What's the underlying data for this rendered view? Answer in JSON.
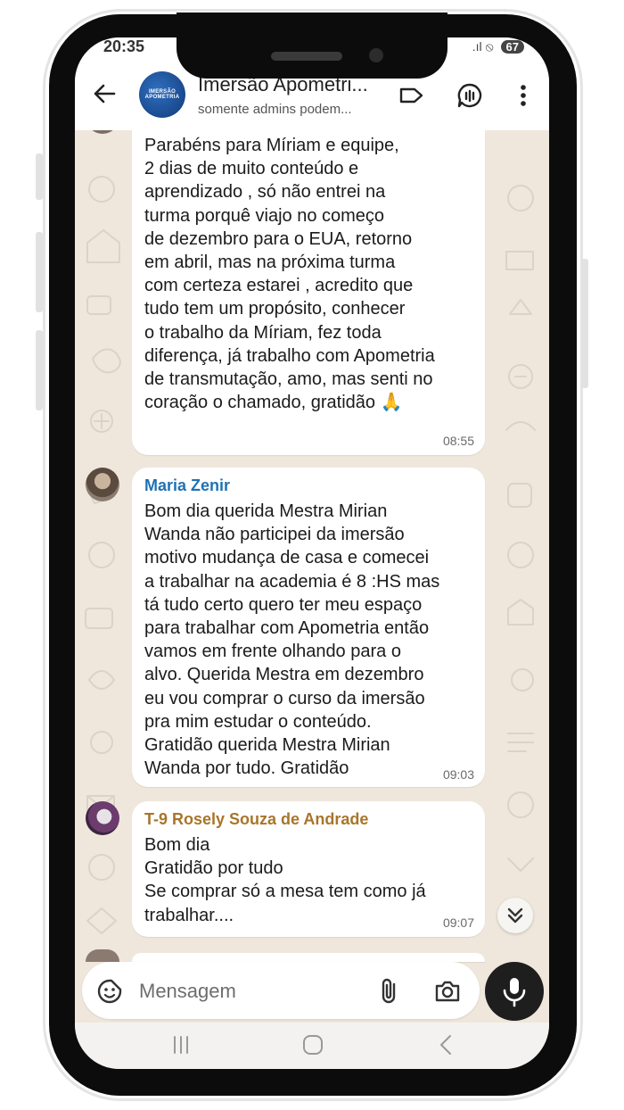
{
  "status_bar": {
    "time": "20:35",
    "battery": "67"
  },
  "header": {
    "avatar_text": "IMERSÃO APOMETRIA",
    "title": "Imersão Apometri...",
    "subtitle": "somente admins podem..."
  },
  "messages": [
    {
      "sender": "",
      "text": "Parabéns para Míriam e equipe,\n2 dias de muito conteúdo e\naprendizado , só não entrei na\nturma porquê viajo no começo\nde dezembro para o EUA, retorno\nem abril, mas na próxima turma\ncom certeza estarei , acredito que\ntudo tem um propósito, conhecer\no trabalho da Míriam, fez toda\ndiferença, já trabalho com Apometria\nde transmutação, amo, mas senti no\ncoração o chamado, gratidão 🙏",
      "time": "08:55"
    },
    {
      "sender": "Maria Zenir",
      "sender_color": "#1f72b3",
      "text": "Bom dia querida Mestra Mirian\nWanda não participei da imersão\nmotivo mudança de casa e comecei\na trabalhar na academia é 8 :HS  mas\ntá tudo certo quero ter meu espaço\npara trabalhar com Apometria então\nvamos em frente olhando para o\nalvo. Querida Mestra em dezembro\neu vou comprar o curso da imersão\npra mim estudar o conteúdo.\nGratidão querida Mestra Mirian\nWanda por tudo. Gratidão",
      "time": "09:03"
    },
    {
      "sender": "T-9 Rosely Souza de Andrade",
      "sender_color": "#a8752a",
      "text": "Bom dia\nGratidão por tudo\nSe comprar só a mesa tem como já\ntrabalhar....",
      "time": "09:07"
    }
  ],
  "input": {
    "placeholder": "Mensagem"
  },
  "icons": {
    "back": "arrow-left-icon",
    "label": "label-icon",
    "voice_chat": "voice-chat-icon",
    "menu": "more-vertical-icon",
    "emoji": "sticker-icon",
    "attach": "paperclip-icon",
    "camera": "camera-icon",
    "mic": "mic-icon",
    "scroll": "double-chevron-down-icon"
  }
}
